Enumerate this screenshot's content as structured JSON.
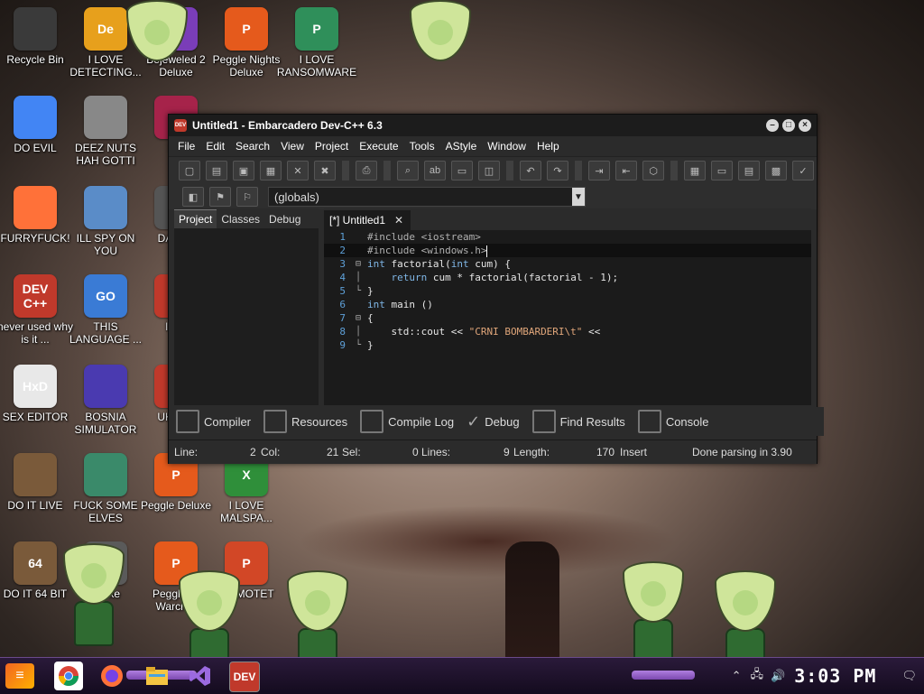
{
  "desktop_icons": [
    {
      "label": "Recycle Bin",
      "color": "#3a3a3a"
    },
    {
      "label": "I LOVE DETECTING...",
      "color": "#e7a01c",
      "glyph": "De"
    },
    {
      "label": "Bejeweled 2 Deluxe",
      "color": "#7a3db8"
    },
    {
      "label": "Peggle Nights Deluxe",
      "color": "#e55a1c",
      "glyph": "P"
    },
    {
      "label": "I LOVE RANSOMWARE",
      "color": "#2f8f5a",
      "glyph": "P"
    },
    {
      "label": "DO EVIL",
      "color": "#4285f4"
    },
    {
      "label": "DEEZ NUTS HAH GOTTI",
      "color": "#888888"
    },
    {
      "label": "Bej",
      "color": "#a6234a"
    },
    {
      "label": "FURRYFUCK!",
      "color": "#ff7139"
    },
    {
      "label": "ILL SPY ON YOU",
      "color": "#5a8cc8"
    },
    {
      "label": "DA SIM",
      "color": "#555555"
    },
    {
      "label": "never used why is it ...",
      "color": "#c0392b",
      "glyph": "DEV C++"
    },
    {
      "label": "THIS LANGUAGE ...",
      "color": "#3a7bd5",
      "glyph": "GO"
    },
    {
      "label": "I CH",
      "color": "#c0392b"
    },
    {
      "label": "SEX EDITOR",
      "color": "#e8e8e8",
      "glyph": "HxD"
    },
    {
      "label": "BOSNIA SIMULATOR",
      "color": "#4a3ab0"
    },
    {
      "label": "UK SIM",
      "color": "#c0392b"
    },
    {
      "label": "DO IT LIVE",
      "color": "#7a5a3a"
    },
    {
      "label": "FUCK SOME ELVES",
      "color": "#3a8a6a"
    },
    {
      "label": "Peggle Deluxe",
      "color": "#e55a1c",
      "glyph": "P"
    },
    {
      "label": "I LOVE MALSPA...",
      "color": "#2f8f3a",
      "glyph": "X"
    },
    {
      "label": "DO IT 64 BIT",
      "color": "#7a5a3a",
      "glyph": "64"
    },
    {
      "label": "led xe",
      "color": "#5a5a5a"
    },
    {
      "label": "Peggle W Warcraft",
      "color": "#e55a1c",
      "glyph": "P"
    },
    {
      "label": "E EMOTET",
      "color": "#d24726",
      "glyph": "P"
    }
  ],
  "window": {
    "title": "Untitled1 - Embarcadero Dev-C++ 6.3",
    "app_icon": "DEV",
    "menu": [
      "File",
      "Edit",
      "Search",
      "View",
      "Project",
      "Execute",
      "Tools",
      "AStyle",
      "Window",
      "Help"
    ],
    "scope_select": "(globals)",
    "left_tabs": [
      "Project",
      "Classes",
      "Debug"
    ],
    "editor_tab": "[*] Untitled1",
    "code_lines": [
      {
        "num": "1",
        "fold": "",
        "parts": [
          {
            "t": "#include <iostream>",
            "c": "pp"
          }
        ]
      },
      {
        "num": "2",
        "fold": "",
        "parts": [
          {
            "t": "#include <windows.h>",
            "c": "pp"
          }
        ]
      },
      {
        "num": "3",
        "fold": "⊟",
        "parts": [
          {
            "t": "int",
            "c": "kw"
          },
          {
            "t": " factorial(",
            "c": ""
          },
          {
            "t": "int",
            "c": "kw"
          },
          {
            "t": " cum) {",
            "c": ""
          }
        ]
      },
      {
        "num": "4",
        "fold": "│",
        "parts": [
          {
            "t": "    ",
            "c": ""
          },
          {
            "t": "return",
            "c": "kw"
          },
          {
            "t": " cum * factorial(factorial - 1);",
            "c": ""
          }
        ]
      },
      {
        "num": "5",
        "fold": "└",
        "parts": [
          {
            "t": "}",
            "c": ""
          }
        ]
      },
      {
        "num": "6",
        "fold": "",
        "parts": [
          {
            "t": "int",
            "c": "kw"
          },
          {
            "t": " main ()",
            "c": ""
          }
        ]
      },
      {
        "num": "7",
        "fold": "⊟",
        "parts": [
          {
            "t": "{",
            "c": ""
          }
        ]
      },
      {
        "num": "8",
        "fold": "│",
        "parts": [
          {
            "t": "    std::cout << ",
            "c": ""
          },
          {
            "t": "\"CRNI BOMBARDERI\\t\"",
            "c": "str"
          },
          {
            "t": " <<",
            "c": ""
          }
        ]
      },
      {
        "num": "9",
        "fold": "└",
        "parts": [
          {
            "t": "}",
            "c": ""
          }
        ]
      }
    ],
    "bottom_tabs": [
      "Compiler",
      "Resources",
      "Compile Log",
      "Debug",
      "Find Results",
      "Console"
    ],
    "status": {
      "line_label": "Line:",
      "line_value": "2",
      "col_label": "Col:",
      "col_value": "21",
      "sel_label": "Sel:",
      "sel_value": "0",
      "lines_label": "Lines:",
      "lines_value": "9",
      "length_label": "Length:",
      "length_value": "170",
      "mode": "Insert",
      "message": "Done parsing in 3.90"
    }
  },
  "taskbar": {
    "start_glyph": "≡",
    "apps": [
      "chrome",
      "firefox",
      "file-explorer",
      "visual-studio",
      "dev-cpp"
    ],
    "clock": "3:03 PM"
  }
}
